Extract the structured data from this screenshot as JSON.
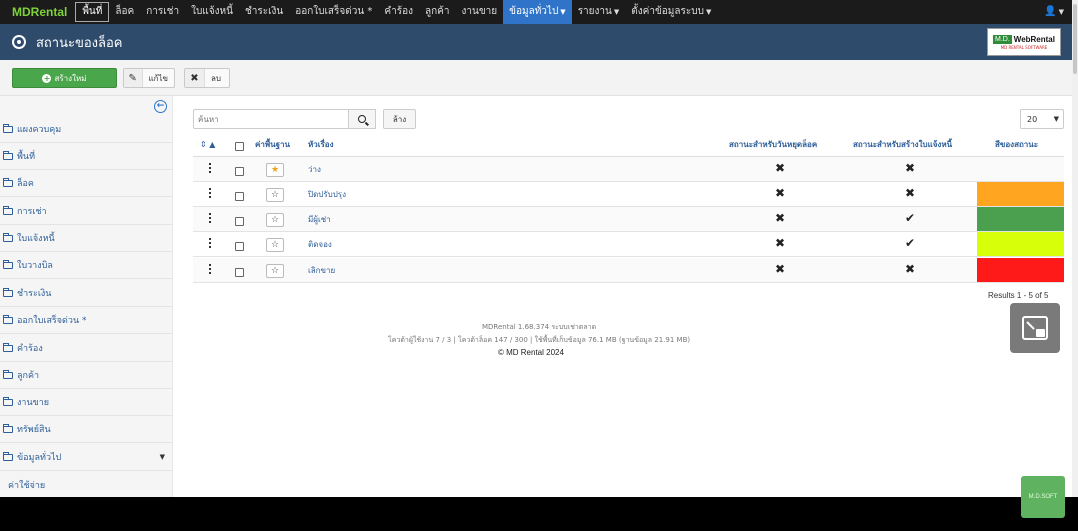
{
  "navbar": {
    "brand": "MDRental",
    "items": [
      {
        "label": "พื้นที่"
      },
      {
        "label": "ล็อค"
      },
      {
        "label": "การเช่า"
      },
      {
        "label": "ใบแจ้งหนี้"
      },
      {
        "label": "ชำระเงิน"
      },
      {
        "label": "ออกใบเสร็จด่วน *"
      },
      {
        "label": "คำร้อง"
      },
      {
        "label": "ลูกค้า"
      },
      {
        "label": "งานขาย"
      },
      {
        "label": "ข้อมูลทั่วไป"
      },
      {
        "label": "รายงาน"
      },
      {
        "label": "ตั้งค่าข้อมูลระบบ"
      }
    ],
    "user_icon": "user-icon"
  },
  "header": {
    "title": "สถานะของล็อค",
    "logo": {
      "md": "M.D.",
      "name": "WebRental",
      "sub": "MD RENTAL SOFTWARE"
    }
  },
  "toolbar": {
    "new_label": "สร้างใหม่",
    "edit_label": "แก้ไข",
    "delete_label": "ลบ"
  },
  "sidebar": {
    "items": [
      {
        "label": "แผงควบคุม"
      },
      {
        "label": "พื้นที่"
      },
      {
        "label": "ล็อค"
      },
      {
        "label": "การเช่า"
      },
      {
        "label": "ใบแจ้งหนี้"
      },
      {
        "label": "ใบวางบิล"
      },
      {
        "label": "ชำระเงิน"
      },
      {
        "label": "ออกใบเสร็จด่วน *"
      },
      {
        "label": "คำร้อง"
      },
      {
        "label": "ลูกค้า"
      },
      {
        "label": "งานขาย"
      },
      {
        "label": "ทรัพย์สิน"
      },
      {
        "label": "ข้อมูลทั่วไป"
      }
    ],
    "plain_item": "ค่าใช้จ่าย"
  },
  "filters": {
    "search_placeholder": "ค้นหา",
    "clear_label": "ล้าง",
    "limit": "20"
  },
  "table": {
    "columns": {
      "default": "ค่าพื้นฐาน",
      "title": "หัวเรื่อง",
      "holiday": "สถานะสำหรับวันหยุดล็อค",
      "invoice": "สถานะสำหรับสร้างใบแจ้งหนี้",
      "color": "สีของสถานะ"
    },
    "rows": [
      {
        "title": "ว่าง",
        "is_default": true,
        "holiday": "✖",
        "invoice": "✖",
        "color": ""
      },
      {
        "title": "ปิดปรับปรุง",
        "is_default": false,
        "holiday": "✖",
        "invoice": "✖",
        "color": "#ffa51f"
      },
      {
        "title": "มีผู้เช่า",
        "is_default": false,
        "holiday": "✖",
        "invoice": "✔",
        "color": "#4aa04f"
      },
      {
        "title": "ติดจอง",
        "is_default": false,
        "holiday": "✖",
        "invoice": "✔",
        "color": "#d8ff0a"
      },
      {
        "title": "เลิกขาย",
        "is_default": false,
        "holiday": "✖",
        "invoice": "✖",
        "color": "#ff1a1a"
      }
    ],
    "results": "Results 1 - 5 of 5"
  },
  "footer": {
    "version": "MDRental 1.68.374 ระบบเช่าตลาด",
    "stats": "โควต้าผู้ใช้งาน  7 / 3 | โควต้าล็อค  147 / 300 | ใช้พื้นที่เก็บข้อมูล 76.1 MB (ฐานข้อมูล 21.91 MB)",
    "copyright": "© MD Rental 2024"
  },
  "badge": "M.D.SOFT"
}
